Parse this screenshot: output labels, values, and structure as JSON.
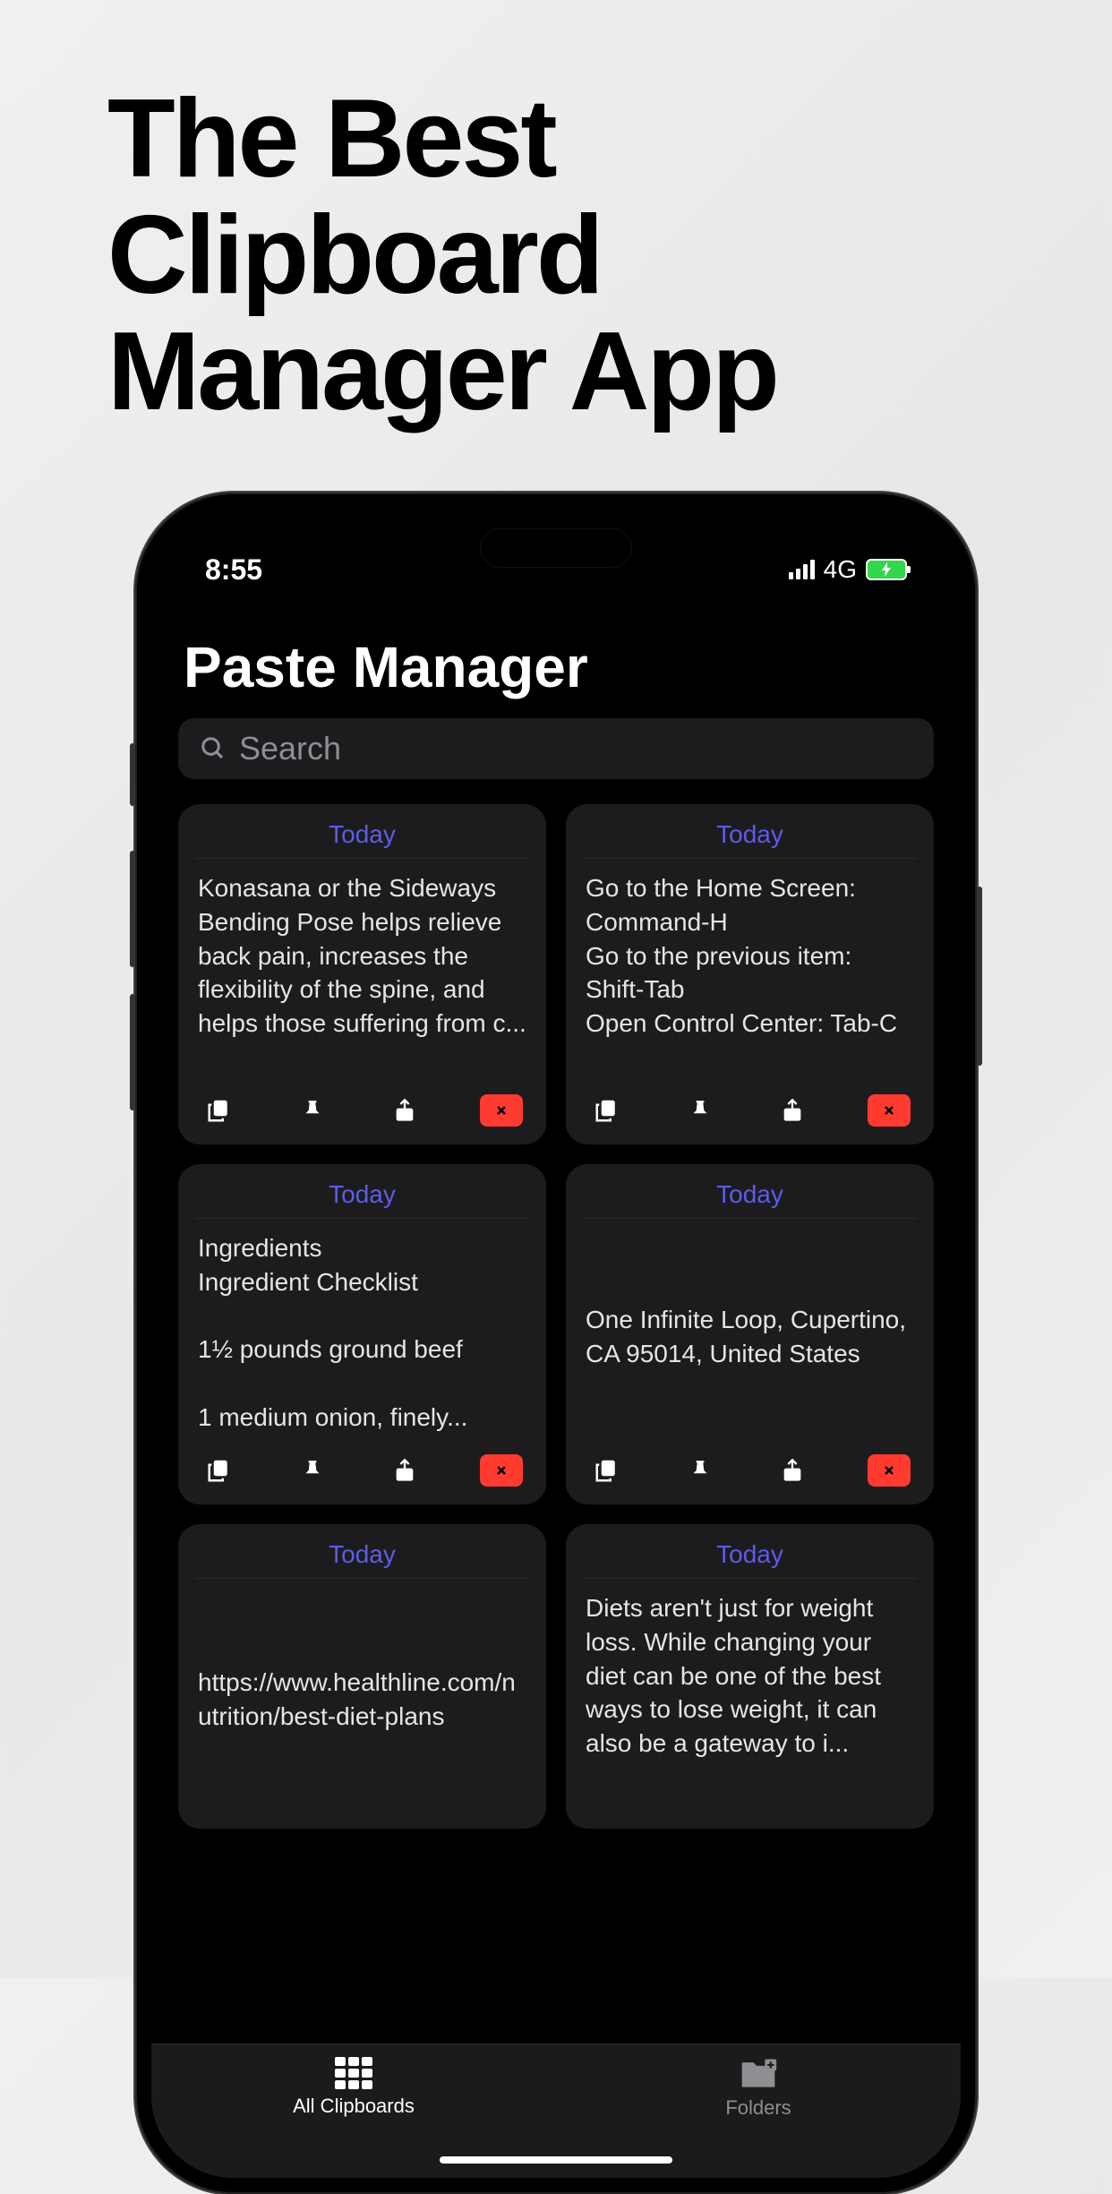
{
  "marketing": {
    "headline": "The Best Clipboard Manager App"
  },
  "statusBar": {
    "time": "8:55",
    "network": "4G"
  },
  "app": {
    "title": "Paste Manager",
    "searchPlaceholder": "Search"
  },
  "cards": [
    {
      "date": "Today",
      "text": "Konasana or the Sideways Bending Pose helps relieve back pain, increases the flexibility of the spine, and helps those suffering from c..."
    },
    {
      "date": "Today",
      "text": "Go to the Home Screen: Command-H\nGo to the previous item: Shift-Tab\nOpen Control Center: Tab-C"
    },
    {
      "date": "Today",
      "text": "Ingredients\nIngredient Checklist\n\n1½ pounds ground beef\n\n1 medium onion, finely..."
    },
    {
      "date": "Today",
      "text": "One Infinite Loop, Cupertino, CA 95014, United States"
    },
    {
      "date": "Today",
      "text": "https://www.healthline.com/nutrition/best-diet-plans"
    },
    {
      "date": "Today",
      "text": "Diets aren't just for weight loss. While changing your diet can be one of the best ways to lose weight, it can also be a gateway to i..."
    }
  ],
  "tabs": {
    "all": "All Clipboards",
    "folders": "Folders"
  }
}
